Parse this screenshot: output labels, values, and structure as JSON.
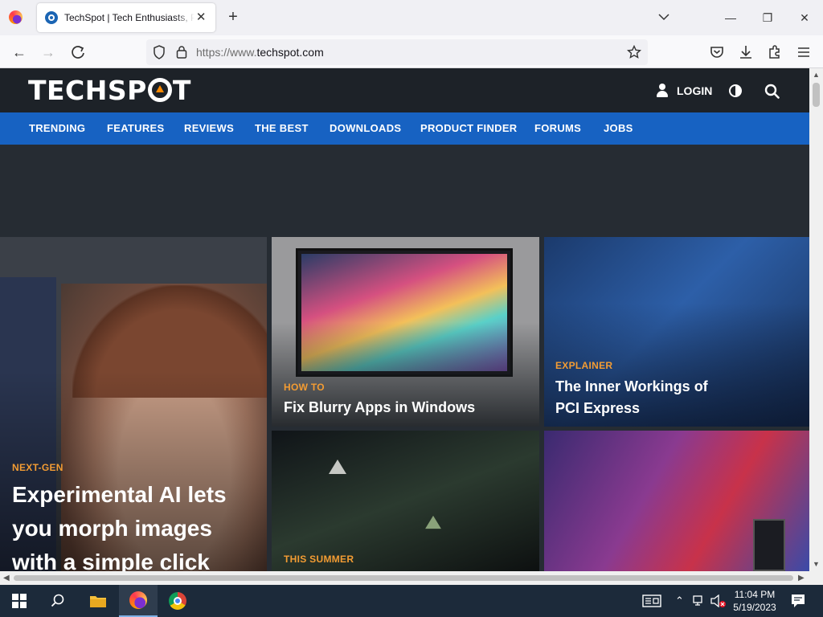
{
  "browser": {
    "tab_title": "TechSpot | Tech Enthusiasts, Power Users",
    "url_prefix": "https://www.",
    "url_domain": "techspot.com"
  },
  "site": {
    "logo_left": "TECHSP",
    "logo_right": "T",
    "login_label": "LOGIN",
    "nav": [
      "TRENDING",
      "FEATURES",
      "REVIEWS",
      "THE BEST",
      "DOWNLOADS",
      "PRODUCT FINDER",
      "FORUMS",
      "JOBS"
    ],
    "cards": [
      {
        "tag": "NEXT-GEN",
        "title": "Experimental AI lets you morph images with a simple click and"
      },
      {
        "tag": "HOW TO",
        "title": "Fix Blurry Apps in Windows"
      },
      {
        "tag": "EXPLAINER",
        "title": "The Inner Workings of PCI Express"
      },
      {
        "tag": "THIS SUMMER",
        "title": ""
      }
    ]
  },
  "taskbar": {
    "time": "11:04 PM",
    "date": "5/19/2023"
  },
  "colors": {
    "nav_bar": "#1762c2",
    "tag_orange": "#f39c33",
    "header_dark": "#1d2228"
  }
}
